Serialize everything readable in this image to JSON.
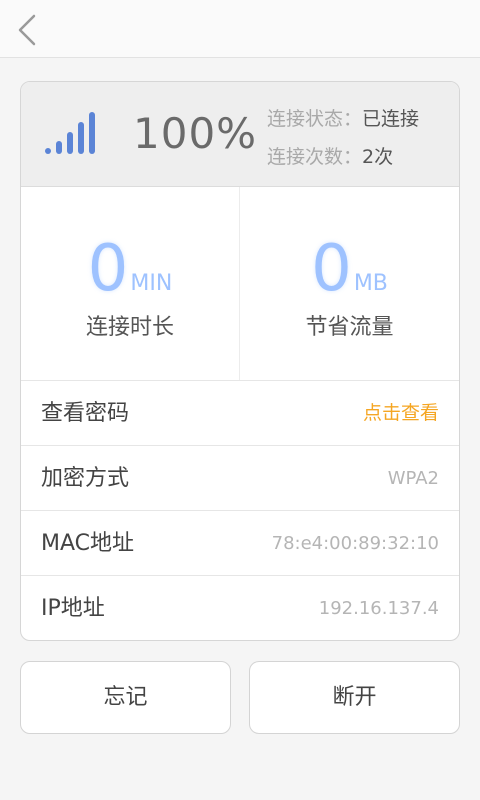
{
  "colors": {
    "accent_blue": "#9ec2ff",
    "signal_blue": "#5b84d6",
    "link_orange": "#f5a623"
  },
  "nav": {
    "back_icon": "chevron-left-icon"
  },
  "status": {
    "signal_icon": "wifi-signal-bars-icon",
    "signal_level": 1.0,
    "percent": "100%",
    "state_label": "连接状态：",
    "state_value": "已连接",
    "count_label": "连接次数：",
    "count_value": "2次"
  },
  "stats": {
    "duration": {
      "value": "0",
      "unit": "MIN",
      "label": "连接时长"
    },
    "saved": {
      "value": "0",
      "unit": "MB",
      "label": "节省流量"
    }
  },
  "info": {
    "password": {
      "label": "查看密码",
      "value": "点击查看"
    },
    "encryption": {
      "label": "加密方式",
      "value": "WPA2"
    },
    "mac": {
      "label": "MAC地址",
      "value": "78:e4:00:89:32:10"
    },
    "ip": {
      "label": "IP地址",
      "value": "192.16.137.4"
    }
  },
  "actions": {
    "forget_label": "忘记",
    "disconnect_label": "断开"
  }
}
